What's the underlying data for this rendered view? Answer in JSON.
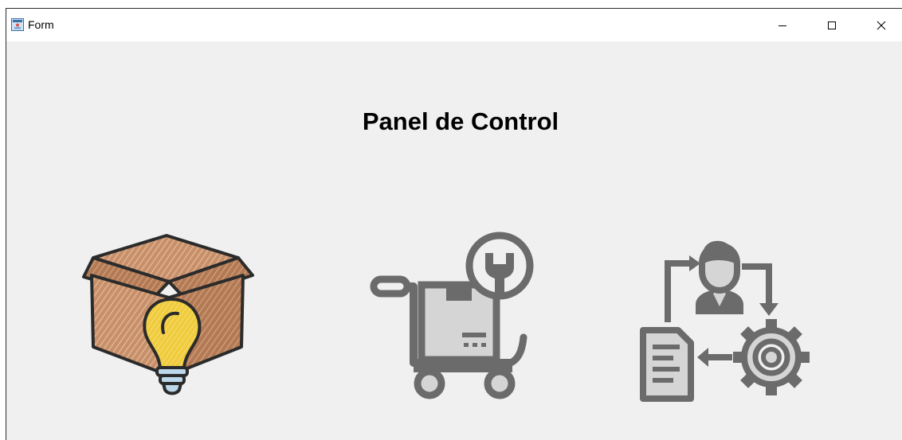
{
  "window": {
    "title": "Form",
    "app_icon": "form-app-icon",
    "controls": {
      "minimize": "minimize-icon",
      "maximize": "maximize-icon",
      "close": "close-icon"
    }
  },
  "main": {
    "heading": "Panel de Control",
    "tiles": [
      {
        "icon": "box-lightbulb-icon"
      },
      {
        "icon": "cart-wrench-icon"
      },
      {
        "icon": "user-workflow-gear-icon"
      }
    ]
  },
  "colors": {
    "window_bg": "#f0f0f0",
    "titlebar_bg": "#ffffff",
    "icon_gray": "#6b6b6b",
    "box_brown": "#c8906a",
    "bulb_yellow": "#f0cc3c"
  }
}
